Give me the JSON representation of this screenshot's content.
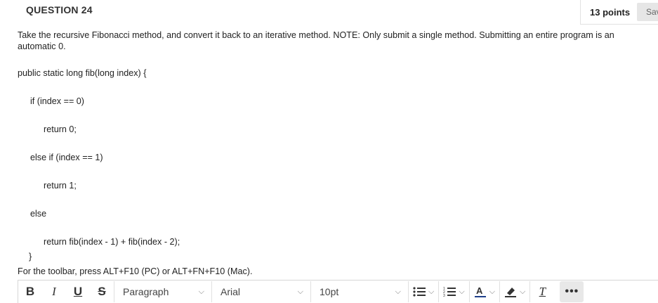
{
  "question": {
    "title": "QUESTION 24",
    "points": "13 points",
    "save_label": "Save Answer",
    "text": "Take the recursive Fibonacci method, and convert it back to an iterative method. NOTE: Only submit a single method. Submitting an entire program is an automatic 0.",
    "code_lines": [
      "public static long fib(long index) {",
      "if (index == 0)",
      "return 0;",
      "else if (index == 1)",
      "return 1;",
      "else",
      "return fib(index - 1) + fib(index - 2);",
      "}"
    ]
  },
  "editor": {
    "hint": "For the toolbar, press ALT+F10 (PC) or ALT+FN+F10 (Mac).",
    "toolbar": {
      "bold": "B",
      "italic": "I",
      "underline": "U",
      "strike": "S",
      "paragraph": "Paragraph",
      "font": "Arial",
      "size": "10pt",
      "clear_format": "T",
      "more": "•••"
    }
  },
  "colors": {
    "text": "#222222",
    "save_bg": "#e6e6e6",
    "more_bg": "#e8e8e8",
    "border": "#d6d6d6"
  }
}
